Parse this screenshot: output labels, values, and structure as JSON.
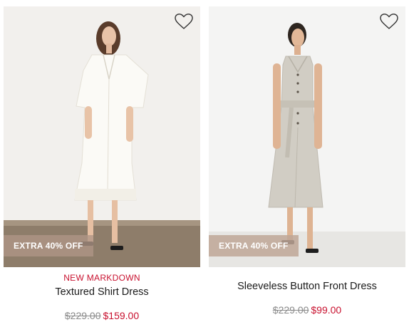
{
  "products": [
    {
      "badge": "EXTRA 40% OFF",
      "flag": "NEW MARKDOWN",
      "name": "Textured Shirt Dress",
      "original_price": "$229.00",
      "sale_price": "$159.00"
    },
    {
      "badge": "EXTRA 40% OFF",
      "flag": "",
      "name": "Sleeveless Button Front Dress",
      "original_price": "$229.00",
      "sale_price": "$99.00"
    }
  ],
  "icons": {
    "wishlist": "heart-outline-icon"
  },
  "colors": {
    "sale": "#c8102e",
    "badge": "#b09686",
    "strike": "#8a8a8a"
  }
}
